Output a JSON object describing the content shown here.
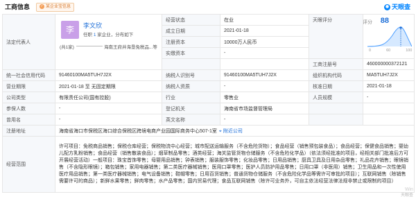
{
  "header": {
    "title": "工商信息",
    "chip": "某企业宝信息",
    "logo": "天眼查"
  },
  "legal_rep": {
    "label": "法定代表人",
    "avatar": "李",
    "name": "李文欣",
    "meta_prefix": "任职",
    "meta_count": "1",
    "meta_suffix": "家企业，分布如下",
    "tag": "(共1家)",
    "branch": "海南王府井海垦免税品...等"
  },
  "rows_top": [
    {
      "label": "经营状态",
      "value": "在业"
    },
    {
      "label": "成立日期",
      "value": "2021-01-18"
    },
    {
      "label": "注册资本",
      "value": "10000万人民币"
    },
    {
      "label": "实缴资本",
      "value": "-"
    }
  ],
  "score": {
    "label": "天眼评分",
    "word": "评分",
    "value": "88",
    "legend": [
      "0",
      "60",
      "100"
    ]
  },
  "biz_reg": {
    "label": "工商注册号",
    "value": "460000000372121"
  },
  "rows": [
    [
      {
        "label": "统一社会信用代码",
        "value": "91460100MA5TUH7J2X"
      },
      {
        "label": "纳税人识别号",
        "value": "91460100MA5TUH7J2X"
      },
      {
        "label": "组织机构代码",
        "value": "MA5TUH7J2X"
      }
    ],
    [
      {
        "label": "营业期限",
        "value": "2021-01-18 至 无固定期限"
      },
      {
        "label": "纳税人资质",
        "value": "-"
      },
      {
        "label": "核准日期",
        "value": "2021-01-18"
      }
    ],
    [
      {
        "label": "公司类型",
        "value": "有限责任公司(国有控股)"
      },
      {
        "label": "行业",
        "value": "零售业"
      },
      {
        "label": "人员规模",
        "value": "-"
      }
    ],
    [
      {
        "label": "参保人数",
        "value": "-"
      },
      {
        "label": "登记机关",
        "value": "海南省市场监督管理局"
      },
      {
        "label": "",
        "value": ""
      }
    ],
    [
      {
        "label": "曾用名",
        "value": "-"
      },
      {
        "label": "英文名称",
        "value": "-"
      },
      {
        "label": "",
        "value": ""
      }
    ]
  ],
  "address": {
    "label": "注册地址",
    "value": "海南省海口市保税区海口综合保税区跨境电商产业园国际商务中心507-1室",
    "link": "附近公司"
  },
  "scope": {
    "label": "经营范围",
    "value": "许可项目：免税商品销售；保税仓库经营；保税物流中心经营；城市配送运输服务（不含危险货物）；食品经营（销售预包装食品）；食品经营；保健食品销售；婴幼儿配方乳粉销售；食品经营（销售散装食品）；烟草制品零售；酒类经营；海关监管货物仓储服务（不含危险化学品）（依法须经批准的项目，经相关部门批准后方可开展经营活动）一般项目：珠宝首饰零售；母婴用品销售；钟表销售；服装服饰零售；化妆品零售；日用品销售；厨具卫具及日用杂品零售；礼品花卉销售；眼镜销售（不含隐形眼镜）；箱包销售；家用电器销售；第二类医疗器械销售；医用口罩零售；医护人员防护用品零售；日用口罩（非医用）销售；卫生用品和一次性使用医疗用品销售；第一类医疗器械销售；电气设备销售；鞋帽零售；日用百货销售；普通货物仓储服务（不含危险化学品等需许可审批的项目）；互联网销售（除销售需要许可的商品）；新鲜水果零售；鲜肉零售；水产品零售；国内贸易代理；食品互联网销售（除许可业务外，可自主依法经营法律法规非禁止或限制的项目）"
  },
  "watermark": [
    "Win",
    "天眼查"
  ]
}
